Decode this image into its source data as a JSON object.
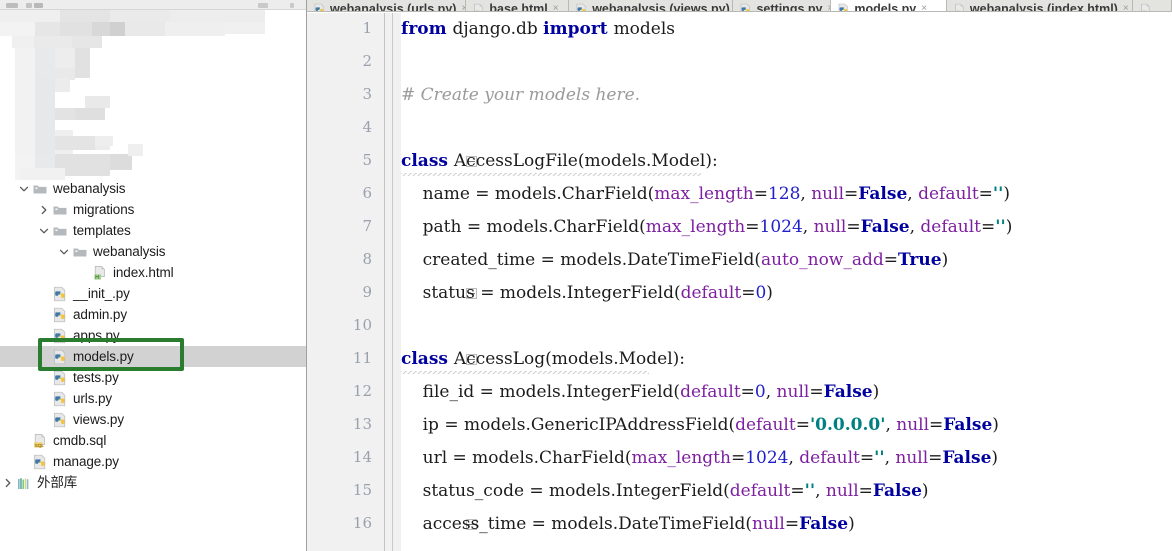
{
  "sidebar": {
    "toolbar_name": "project-toolbar",
    "censored_note": "blurred-region",
    "tree": [
      {
        "indent": 0,
        "arrow": "chevron-down",
        "icon": "folder-icon",
        "label": "webanalysis",
        "selected": false,
        "name": "tree-item-webanalysis"
      },
      {
        "indent": 1,
        "arrow": "chevron-right",
        "icon": "folder-icon",
        "label": "migrations",
        "selected": false,
        "name": "tree-item-migrations"
      },
      {
        "indent": 1,
        "arrow": "chevron-down",
        "icon": "folder-icon",
        "label": "templates",
        "selected": false,
        "name": "tree-item-templates"
      },
      {
        "indent": 2,
        "arrow": "chevron-down",
        "icon": "folder-icon",
        "label": "webanalysis",
        "selected": false,
        "name": "tree-item-templates-webanalysis"
      },
      {
        "indent": 3,
        "arrow": "none",
        "icon": "html-file-icon",
        "label": "index.html",
        "selected": false,
        "name": "tree-item-index-html"
      },
      {
        "indent": 1,
        "arrow": "none",
        "icon": "python-file-icon",
        "label": "__init_.py",
        "selected": false,
        "name": "tree-item-init-py"
      },
      {
        "indent": 1,
        "arrow": "none",
        "icon": "python-file-icon",
        "label": "admin.py",
        "selected": false,
        "name": "tree-item-admin-py"
      },
      {
        "indent": 1,
        "arrow": "none",
        "icon": "python-file-icon",
        "label": "apps.py",
        "selected": false,
        "name": "tree-item-apps-py"
      },
      {
        "indent": 1,
        "arrow": "none",
        "icon": "python-file-icon",
        "label": "models.py",
        "selected": true,
        "name": "tree-item-models-py"
      },
      {
        "indent": 1,
        "arrow": "none",
        "icon": "python-file-icon",
        "label": "tests.py",
        "selected": false,
        "name": "tree-item-tests-py"
      },
      {
        "indent": 1,
        "arrow": "none",
        "icon": "python-file-icon",
        "label": "urls.py",
        "selected": false,
        "name": "tree-item-urls-py"
      },
      {
        "indent": 1,
        "arrow": "none",
        "icon": "python-file-icon",
        "label": "views.py",
        "selected": false,
        "name": "tree-item-views-py"
      },
      {
        "indent": 0,
        "arrow": "none",
        "icon": "sql-file-icon",
        "label": "cmdb.sql",
        "selected": false,
        "name": "tree-item-cmdb-sql"
      },
      {
        "indent": 0,
        "arrow": "none",
        "icon": "python-file-icon",
        "label": "manage.py",
        "selected": false,
        "name": "tree-item-manage-py"
      },
      {
        "indent": -1,
        "arrow": "chevron-right",
        "icon": "libraries-icon",
        "label": "外部库",
        "selected": false,
        "name": "tree-item-external-libraries"
      }
    ],
    "annotation": {
      "name": "green-highlight-box",
      "color": "#2a7d2e",
      "target": "models.py"
    }
  },
  "editor": {
    "tabs": [
      {
        "label": "webanalysis (urls.py)",
        "icon": "python-file-icon",
        "active": false,
        "close": "×",
        "name": "tab-urls-py"
      },
      {
        "label": "base.html",
        "icon": "html-file-icon",
        "active": false,
        "close": "×",
        "name": "tab-base-html"
      },
      {
        "label": "webanalysis (views.py)",
        "icon": "python-file-icon",
        "active": false,
        "close": "×",
        "name": "tab-views-py"
      },
      {
        "label": "settings.py",
        "icon": "python-file-icon",
        "active": false,
        "close": "×",
        "name": "tab-settings-py"
      },
      {
        "label": "models.py",
        "icon": "python-file-icon",
        "active": true,
        "close": "×",
        "name": "tab-models-py"
      },
      {
        "label": "webanalysis (index.html)",
        "icon": "html-file-icon",
        "active": false,
        "close": "×",
        "name": "tab-index-html"
      },
      {
        "label": "",
        "icon": "html-file-icon",
        "active": false,
        "close": "",
        "name": "tab-overflow"
      }
    ],
    "line_numbers": [
      "1",
      "2",
      "3",
      "4",
      "5",
      "6",
      "7",
      "8",
      "9",
      "10",
      "11",
      "12",
      "13",
      "14",
      "15",
      "16"
    ],
    "folds": [
      {
        "line": 5,
        "type": "start",
        "name": "fold-marker-class-accesslogfile"
      },
      {
        "line": 9,
        "type": "end",
        "name": "fold-marker-end-accesslogfile"
      },
      {
        "line": 11,
        "type": "start",
        "name": "fold-marker-class-accesslog"
      },
      {
        "line": 16,
        "type": "end",
        "name": "fold-marker-end-accesslog"
      }
    ],
    "code": [
      {
        "line": 1,
        "tokens": [
          {
            "t": "from ",
            "c": "kw"
          },
          {
            "t": "django.db ",
            "c": "tokdefault"
          },
          {
            "t": "import ",
            "c": "kw"
          },
          {
            "t": "models",
            "c": "tokdefault"
          }
        ]
      },
      {
        "line": 2,
        "tokens": []
      },
      {
        "line": 3,
        "tokens": [
          {
            "t": "# Create your models here.",
            "c": "cmt"
          }
        ]
      },
      {
        "line": 4,
        "tokens": []
      },
      {
        "line": 5,
        "tokens": [
          {
            "t": "class ",
            "c": "kw"
          },
          {
            "t": "AccessLogFile(models.Model):",
            "c": "tokdefault"
          }
        ]
      },
      {
        "line": 6,
        "tokens": [
          {
            "t": "    name = models.CharField(",
            "c": "tokdefault"
          },
          {
            "t": "max_length",
            "c": "kwarg"
          },
          {
            "t": "=",
            "c": "tokdefault"
          },
          {
            "t": "128",
            "c": "num"
          },
          {
            "t": ", ",
            "c": "tokdefault"
          },
          {
            "t": "null",
            "c": "kwarg"
          },
          {
            "t": "=",
            "c": "tokdefault"
          },
          {
            "t": "False",
            "c": "kw"
          },
          {
            "t": ", ",
            "c": "tokdefault"
          },
          {
            "t": "default",
            "c": "kwarg"
          },
          {
            "t": "=",
            "c": "tokdefault"
          },
          {
            "t": "''",
            "c": "str"
          },
          {
            "t": ")",
            "c": "tokdefault"
          }
        ]
      },
      {
        "line": 7,
        "tokens": [
          {
            "t": "    path = models.CharField(",
            "c": "tokdefault"
          },
          {
            "t": "max_length",
            "c": "kwarg"
          },
          {
            "t": "=",
            "c": "tokdefault"
          },
          {
            "t": "1024",
            "c": "num"
          },
          {
            "t": ", ",
            "c": "tokdefault"
          },
          {
            "t": "null",
            "c": "kwarg"
          },
          {
            "t": "=",
            "c": "tokdefault"
          },
          {
            "t": "False",
            "c": "kw"
          },
          {
            "t": ", ",
            "c": "tokdefault"
          },
          {
            "t": "default",
            "c": "kwarg"
          },
          {
            "t": "=",
            "c": "tokdefault"
          },
          {
            "t": "''",
            "c": "str"
          },
          {
            "t": ")",
            "c": "tokdefault"
          }
        ]
      },
      {
        "line": 8,
        "tokens": [
          {
            "t": "    created_time = models.DateTimeField(",
            "c": "tokdefault"
          },
          {
            "t": "auto_now_add",
            "c": "kwarg"
          },
          {
            "t": "=",
            "c": "tokdefault"
          },
          {
            "t": "True",
            "c": "kw"
          },
          {
            "t": ")",
            "c": "tokdefault"
          }
        ]
      },
      {
        "line": 9,
        "tokens": [
          {
            "t": "    status = models.IntegerField(",
            "c": "tokdefault"
          },
          {
            "t": "default",
            "c": "kwarg"
          },
          {
            "t": "=",
            "c": "tokdefault"
          },
          {
            "t": "0",
            "c": "num"
          },
          {
            "t": ")",
            "c": "tokdefault"
          }
        ]
      },
      {
        "line": 10,
        "tokens": []
      },
      {
        "line": 11,
        "tokens": [
          {
            "t": "class ",
            "c": "kw"
          },
          {
            "t": "AccessLog(models.Model):",
            "c": "tokdefault"
          }
        ]
      },
      {
        "line": 12,
        "tokens": [
          {
            "t": "    file_id = models.IntegerField(",
            "c": "tokdefault"
          },
          {
            "t": "default",
            "c": "kwarg"
          },
          {
            "t": "=",
            "c": "tokdefault"
          },
          {
            "t": "0",
            "c": "num"
          },
          {
            "t": ", ",
            "c": "tokdefault"
          },
          {
            "t": "null",
            "c": "kwarg"
          },
          {
            "t": "=",
            "c": "tokdefault"
          },
          {
            "t": "False",
            "c": "kw"
          },
          {
            "t": ")",
            "c": "tokdefault"
          }
        ]
      },
      {
        "line": 13,
        "tokens": [
          {
            "t": "    ip = models.GenericIPAddressField(",
            "c": "tokdefault"
          },
          {
            "t": "default",
            "c": "kwarg"
          },
          {
            "t": "=",
            "c": "tokdefault"
          },
          {
            "t": "'0.0.0.0'",
            "c": "str"
          },
          {
            "t": ", ",
            "c": "tokdefault"
          },
          {
            "t": "null",
            "c": "kwarg"
          },
          {
            "t": "=",
            "c": "tokdefault"
          },
          {
            "t": "False",
            "c": "kw"
          },
          {
            "t": ")",
            "c": "tokdefault"
          }
        ]
      },
      {
        "line": 14,
        "tokens": [
          {
            "t": "    url = models.CharField(",
            "c": "tokdefault"
          },
          {
            "t": "max_length",
            "c": "kwarg"
          },
          {
            "t": "=",
            "c": "tokdefault"
          },
          {
            "t": "1024",
            "c": "num"
          },
          {
            "t": ", ",
            "c": "tokdefault"
          },
          {
            "t": "default",
            "c": "kwarg"
          },
          {
            "t": "=",
            "c": "tokdefault"
          },
          {
            "t": "''",
            "c": "str"
          },
          {
            "t": ", ",
            "c": "tokdefault"
          },
          {
            "t": "null",
            "c": "kwarg"
          },
          {
            "t": "=",
            "c": "tokdefault"
          },
          {
            "t": "False",
            "c": "kw"
          },
          {
            "t": ")",
            "c": "tokdefault"
          }
        ]
      },
      {
        "line": 15,
        "tokens": [
          {
            "t": "    status_code = models.IntegerField(",
            "c": "tokdefault"
          },
          {
            "t": "default",
            "c": "kwarg"
          },
          {
            "t": "=",
            "c": "tokdefault"
          },
          {
            "t": "''",
            "c": "str"
          },
          {
            "t": ", ",
            "c": "tokdefault"
          },
          {
            "t": "null",
            "c": "kwarg"
          },
          {
            "t": "=",
            "c": "tokdefault"
          },
          {
            "t": "False",
            "c": "kw"
          },
          {
            "t": ")",
            "c": "tokdefault"
          }
        ]
      },
      {
        "line": 16,
        "tokens": [
          {
            "t": "    access_time = models.DateTimeField(",
            "c": "tokdefault"
          },
          {
            "t": "null",
            "c": "kwarg"
          },
          {
            "t": "=",
            "c": "tokdefault"
          },
          {
            "t": "False",
            "c": "kw"
          },
          {
            "t": ")",
            "c": "tokdefault"
          }
        ]
      }
    ]
  },
  "colors": {
    "keyword": "#00009f",
    "kwarg": "#7d1fa0",
    "number": "#2020c8",
    "string": "#008080",
    "comment": "#9a9a9a",
    "selection": "#d2d2d2",
    "annotation_green": "#2a7d2e",
    "gutter_bg": "#f1f1f1",
    "tabbar_bg": "#e3e3e0"
  }
}
